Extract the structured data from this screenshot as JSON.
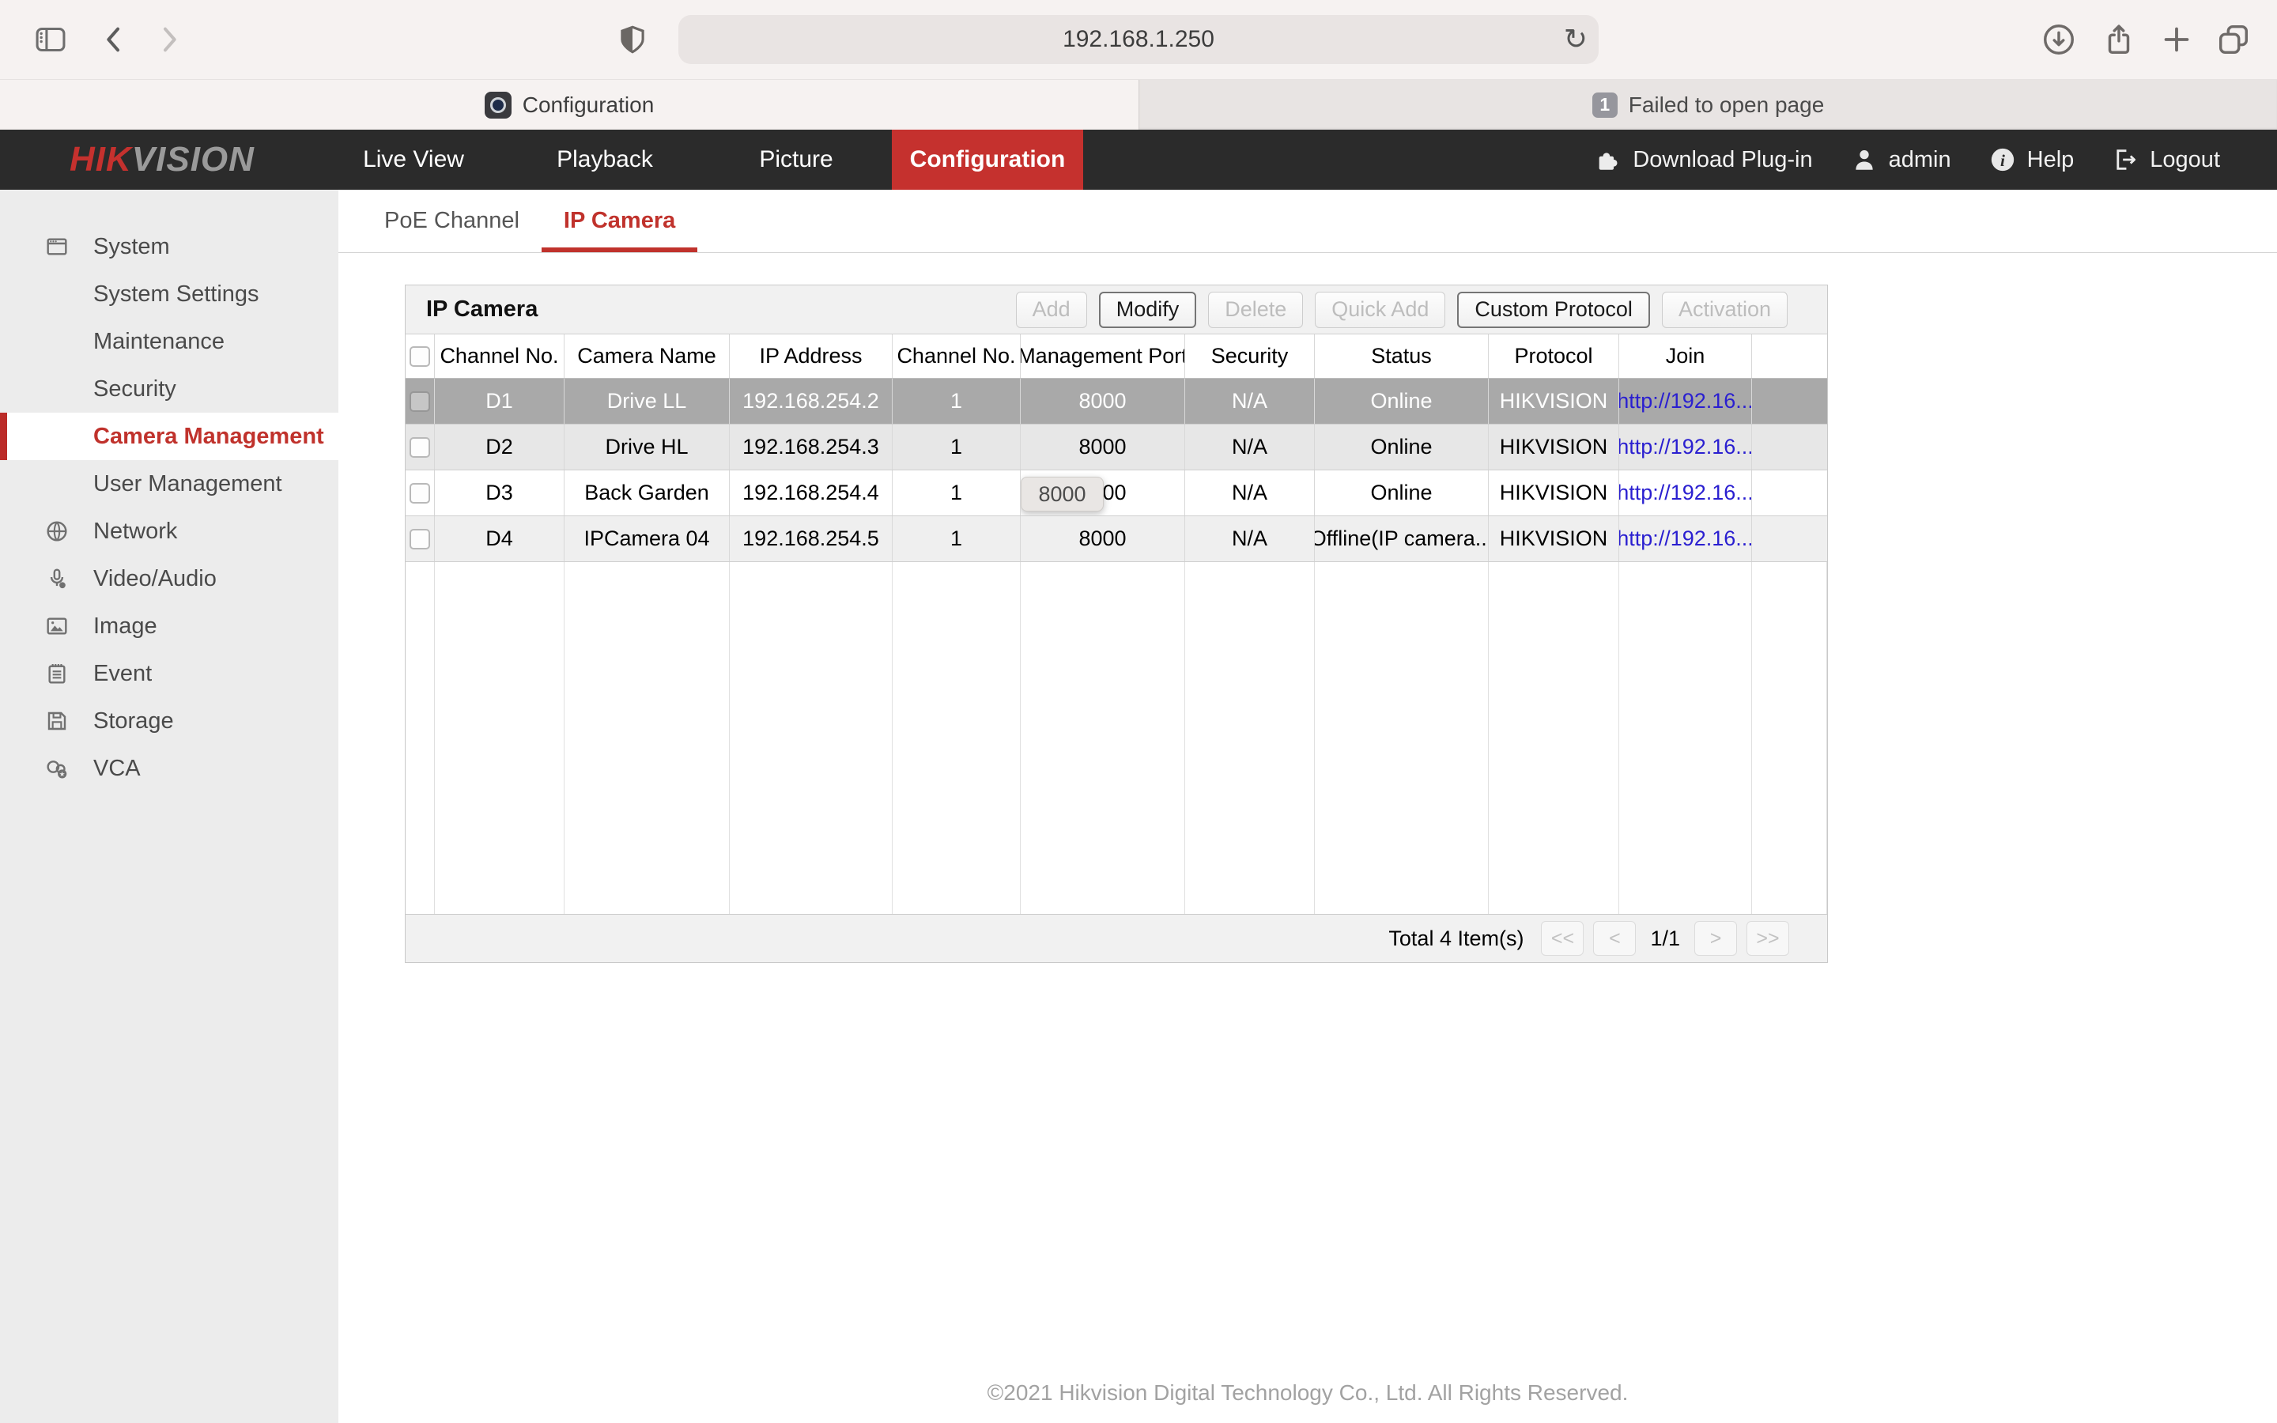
{
  "browser": {
    "url": "192.168.1.250",
    "reload_glyph": "↻",
    "tab1": {
      "label": "Configuration"
    },
    "tab2": {
      "badge": "1",
      "label": "Failed to open page"
    }
  },
  "header": {
    "logo_hik": "HIK",
    "logo_vision": "VISION",
    "nav": [
      {
        "label": "Live View"
      },
      {
        "label": "Playback"
      },
      {
        "label": "Picture"
      },
      {
        "label": "Configuration"
      }
    ],
    "actions": {
      "download_plugin": "Download Plug-in",
      "user": "admin",
      "help": "Help",
      "logout": "Logout"
    }
  },
  "sidebar": {
    "items": [
      {
        "label": "System"
      },
      {
        "label": "System Settings"
      },
      {
        "label": "Maintenance"
      },
      {
        "label": "Security"
      },
      {
        "label": "Camera Management"
      },
      {
        "label": "User Management"
      },
      {
        "label": "Network"
      },
      {
        "label": "Video/Audio"
      },
      {
        "label": "Image"
      },
      {
        "label": "Event"
      },
      {
        "label": "Storage"
      },
      {
        "label": "VCA"
      }
    ]
  },
  "content": {
    "tabs": [
      {
        "label": "PoE Channel"
      },
      {
        "label": "IP Camera"
      }
    ],
    "panel_title": "IP Camera",
    "buttons": [
      {
        "label": "Add",
        "enabled": false
      },
      {
        "label": "Modify",
        "enabled": true
      },
      {
        "label": "Delete",
        "enabled": false
      },
      {
        "label": "Quick Add",
        "enabled": false
      },
      {
        "label": "Custom Protocol",
        "enabled": true
      },
      {
        "label": "Activation",
        "enabled": false
      }
    ],
    "table": {
      "columns": [
        "Channel No.",
        "Camera Name",
        "IP Address",
        "Channel No.",
        "Management Port",
        "Security",
        "Status",
        "Protocol",
        "Join"
      ],
      "rows": [
        {
          "cells": [
            "D1",
            "Drive LL",
            "192.168.254.2",
            "1",
            "8000",
            "N/A",
            "Online",
            "HIKVISION"
          ],
          "join": "http://192.16..."
        },
        {
          "cells": [
            "D2",
            "Drive HL",
            "192.168.254.3",
            "1",
            "8000",
            "N/A",
            "Online",
            "HIKVISION"
          ],
          "join": "http://192.16..."
        },
        {
          "cells": [
            "D3",
            "Back Garden",
            "192.168.254.4",
            "1",
            "8000",
            "N/A",
            "Online",
            "HIKVISION"
          ],
          "join": "http://192.16..."
        },
        {
          "cells": [
            "D4",
            "IPCamera 04",
            "192.168.254.5",
            "1",
            "8000",
            "N/A",
            "Offline(IP camera...",
            "HIKVISION"
          ],
          "join": "http://192.16..."
        }
      ],
      "tooltip": "8000"
    },
    "pagination": {
      "total": "Total 4 Item(s)",
      "first": "<<",
      "prev": "<",
      "page": "1/1",
      "next": ">",
      "last": ">>"
    },
    "copyright": "©2021 Hikvision Digital Technology Co., Ltd. All Rights Reserved."
  },
  "colors": {
    "accent_red": "#c5312e",
    "header_dark": "#2b2b2b",
    "selected_row_gray": "#a9a9a9",
    "link_blue": "#2a1fd0"
  }
}
